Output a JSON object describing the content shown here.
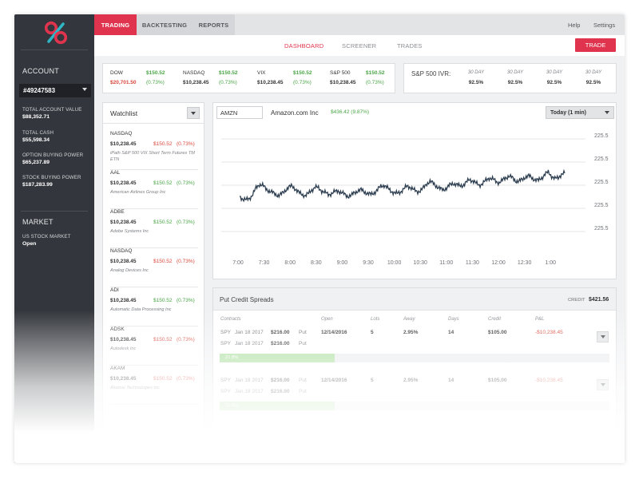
{
  "colors": {
    "accent": "#e0344e",
    "sidebar": "#33363c",
    "up": "#49a545",
    "down": "#d9473b",
    "chart_line": "#2d3e50"
  },
  "logo": {
    "icon": "percent-logo-icon",
    "glyph": "%"
  },
  "topnav": {
    "tabs": [
      "TRADING",
      "BACKTESTING",
      "REPORTS"
    ],
    "help": "Help",
    "settings": "Settings"
  },
  "subnav": {
    "items": [
      "DASHBOARD",
      "SCREENER",
      "TRADES"
    ],
    "trade_button": "TRADE"
  },
  "sidebar": {
    "account_heading": "ACCOUNT",
    "account_number": "#49247583",
    "stats": [
      {
        "label": "TOTAL ACCOUNT VALUE",
        "value": "$88,352.71"
      },
      {
        "label": "TOTAL CASH",
        "value": "$55,598.34"
      },
      {
        "label": "OPTION BUYING POWER",
        "value": "$65,237.89"
      },
      {
        "label": "STOCK BUYING POWER",
        "value": "$187,283.99"
      }
    ],
    "market_heading": "MARKET",
    "market_label": "US STOCK MARKET",
    "market_status": "Open"
  },
  "indices": [
    {
      "name": "DOW",
      "value": "$150.52",
      "price": "$20,701.50",
      "change": "(0.73%)",
      "price_dir": "down"
    },
    {
      "name": "NASDAQ",
      "value": "$150.52",
      "price": "$10,238.45",
      "change": "(0.73%)",
      "price_dir": "neutral"
    },
    {
      "name": "VIX",
      "value": "$150.52",
      "price": "$10,238.45",
      "change": "(0.73%)",
      "price_dir": "neutral"
    },
    {
      "name": "S&P 500",
      "value": "$150.52",
      "price": "$10,238.45",
      "change": "(0.73%)",
      "price_dir": "neutral"
    }
  ],
  "ivr": {
    "title": "S&P 500 IVR:",
    "columns": [
      {
        "label": "30 DAY",
        "value": "92.5%"
      },
      {
        "label": "30 DAY",
        "value": "92.5%"
      },
      {
        "label": "30 DAY",
        "value": "92.5%"
      },
      {
        "label": "30 DAY",
        "value": "92.5%"
      }
    ]
  },
  "watchlist": {
    "title": "Watchlist",
    "items": [
      {
        "symbol": "NASDAQ",
        "price": "$10,238.45",
        "change": "$150.52",
        "pct": "(0.73%)",
        "dir": "down",
        "desc": "iPath S&P 500 VIX Short Term Futures TM ETN"
      },
      {
        "symbol": "AAL",
        "price": "$10,238.45",
        "change": "$150.52",
        "pct": "(0.73%)",
        "dir": "up",
        "desc": "American Airlines Group Inc"
      },
      {
        "symbol": "ADBE",
        "price": "$10,238.45",
        "change": "$150.52",
        "pct": "(0.73%)",
        "dir": "up",
        "desc": "Adobe Systems Inc"
      },
      {
        "symbol": "NASDAQ",
        "price": "$10,238.45",
        "change": "$150.52",
        "pct": "(0.73%)",
        "dir": "down",
        "desc": "Analog Devices Inc"
      },
      {
        "symbol": "ADI",
        "price": "$10,238.45",
        "change": "$150.52",
        "pct": "(0.73%)",
        "dir": "up",
        "desc": "Automatic Data Processing Inc"
      },
      {
        "symbol": "ADSK",
        "price": "$10,238.45",
        "change": "$150.52",
        "pct": "(0.73%)",
        "dir": "down",
        "desc": "Autodesk Inc"
      },
      {
        "symbol": "AKAM",
        "price": "$10,238.45",
        "change": "$150.52",
        "pct": "(0.73%)",
        "dir": "down",
        "desc": "Akamai Technologies Inc"
      }
    ]
  },
  "chart_panel": {
    "symbol_input": "AMZN",
    "name": "Amazon.com Inc",
    "price": "$436.42 (9.87%)",
    "range": "Today (1 min)"
  },
  "chart_data": {
    "type": "line",
    "x_ticks": [
      "7:00",
      "7:30",
      "8:00",
      "8:30",
      "9:00",
      "9:30",
      "10:00",
      "10:30",
      "11:00",
      "11:30",
      "12:00",
      "12:30",
      "1:00"
    ],
    "y_ticks": [
      "225.5",
      "225.5",
      "225.5",
      "225.5",
      "225.5"
    ],
    "grid": true,
    "series": [
      {
        "values": [
          0.38,
          0.35,
          0.34,
          0.36,
          0.4,
          0.47,
          0.51,
          0.5,
          0.46,
          0.44,
          0.42,
          0.4,
          0.39,
          0.41,
          0.45,
          0.48,
          0.49,
          0.46,
          0.42,
          0.4,
          0.39,
          0.41,
          0.45,
          0.48,
          0.47,
          0.44,
          0.42,
          0.4,
          0.41,
          0.43,
          0.44,
          0.42,
          0.4,
          0.38,
          0.39,
          0.42,
          0.44,
          0.45,
          0.43,
          0.41,
          0.4,
          0.42,
          0.45,
          0.49,
          0.5,
          0.47,
          0.44,
          0.42,
          0.41,
          0.43,
          0.46,
          0.49,
          0.48,
          0.45,
          0.43,
          0.44,
          0.47,
          0.52,
          0.54,
          0.52,
          0.49,
          0.46,
          0.45,
          0.47,
          0.5,
          0.52,
          0.51,
          0.49,
          0.5,
          0.53,
          0.56,
          0.55,
          0.52,
          0.5,
          0.52,
          0.55,
          0.58,
          0.57,
          0.54,
          0.53,
          0.55,
          0.58,
          0.6,
          0.58,
          0.55,
          0.54,
          0.56,
          0.59,
          0.6,
          0.58,
          0.56,
          0.55,
          0.58,
          0.62,
          0.64,
          0.6,
          0.57,
          0.58,
          0.62,
          0.63
        ]
      }
    ]
  },
  "spreads": {
    "title": "Put Credit Spreads",
    "credit_label": "CREDIT",
    "credit_value": "$421.56",
    "columns": [
      "Contracts",
      "Open",
      "Lots",
      "Away",
      "Days",
      "Credit",
      "P&L"
    ],
    "positions": [
      {
        "legs": [
          {
            "symbol": "SPY",
            "date": "Jan 18 2017",
            "strike": "$216.00",
            "type": "Put"
          },
          {
            "symbol": "SPY",
            "date": "Jan 18 2017",
            "strike": "$216.00",
            "type": "Put"
          }
        ],
        "open": "12/14/2016",
        "lots": "5",
        "away": "2.95%",
        "days": "14",
        "credit": "$105.00",
        "pnl": "-$10,238.45",
        "progress_label": "21.8%",
        "progress": 0.295
      },
      {
        "legs": [
          {
            "symbol": "SPY",
            "date": "Jan 18 2017",
            "strike": "$216.00",
            "type": "Put"
          },
          {
            "symbol": "SPY",
            "date": "Jan 18 2017",
            "strike": "$216.00",
            "type": "Put"
          }
        ],
        "open": "12/14/2016",
        "lots": "5",
        "away": "2.95%",
        "days": "14",
        "credit": "$105.00",
        "pnl": "-$10,238.45",
        "progress_label": "21.8%",
        "progress": 0.295
      }
    ]
  }
}
